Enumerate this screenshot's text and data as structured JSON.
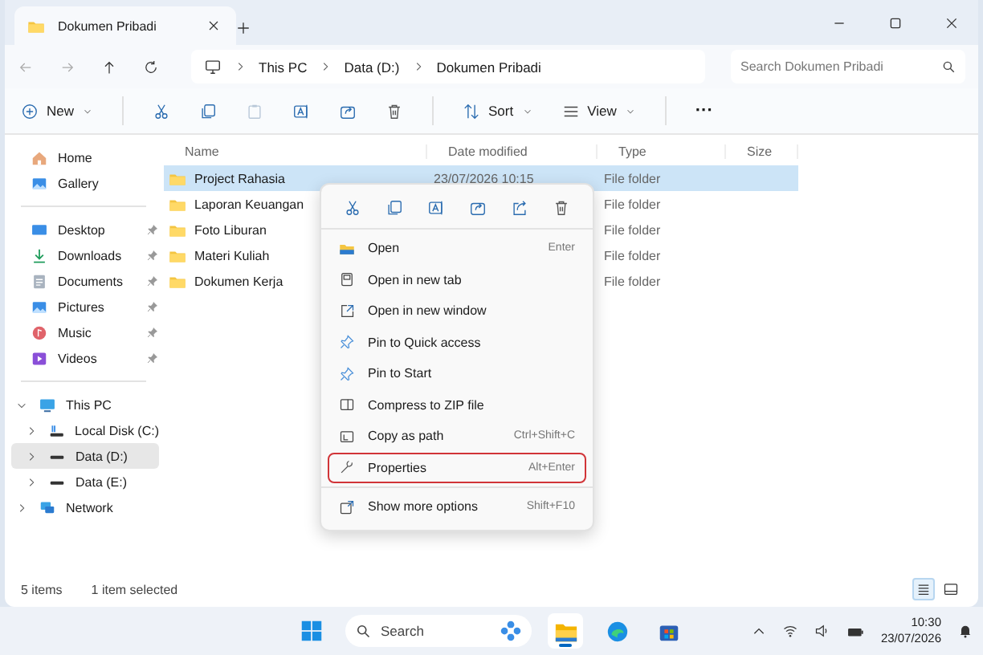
{
  "window": {
    "tab_title": "Dokumen Pribadi"
  },
  "breadcrumb": [
    "This PC",
    "Data (D:)",
    "Dokumen Pribadi"
  ],
  "search": {
    "placeholder": "Search Dokumen Pribadi"
  },
  "toolbar": {
    "new": "New",
    "sort": "Sort",
    "view": "View",
    "more": "···"
  },
  "sidebar": {
    "top": [
      {
        "label": "Home",
        "kind": "home",
        "pinned": false
      },
      {
        "label": "Gallery",
        "kind": "gallery",
        "pinned": false
      }
    ],
    "quick_access": [
      {
        "label": "Desktop",
        "kind": "desktop",
        "pinned": true
      },
      {
        "label": "Downloads",
        "kind": "download",
        "pinned": true
      },
      {
        "label": "Documents",
        "kind": "document",
        "pinned": true
      },
      {
        "label": "Pictures",
        "kind": "picture",
        "pinned": true
      },
      {
        "label": "Music",
        "kind": "music",
        "pinned": true
      },
      {
        "label": "Videos",
        "kind": "video",
        "pinned": true
      }
    ],
    "tree": [
      {
        "label": "This PC",
        "kind": "pc",
        "expanded": true,
        "selected": false,
        "children": [
          {
            "label": "Local Disk (C:)",
            "kind": "system-drive",
            "expanded": false,
            "selected": false
          },
          {
            "label": "Data (D:)",
            "kind": "drive",
            "expanded": false,
            "selected": true
          },
          {
            "label": "Data (E:)",
            "kind": "drive",
            "expanded": false,
            "selected": false
          }
        ]
      },
      {
        "label": "Network",
        "kind": "network",
        "expanded": false,
        "selected": false
      }
    ]
  },
  "table": {
    "columns": [
      "Name",
      "Date modified",
      "Type",
      "Size"
    ],
    "rows": [
      {
        "name": "Project Rahasia",
        "date": "23/07/2026 10:15",
        "type": "File folder",
        "selected": true
      },
      {
        "name": "Laporan Keuangan",
        "type": "File folder",
        "selected": false
      },
      {
        "name": "Foto Liburan",
        "type": "File folder",
        "selected": false
      },
      {
        "name": "Materi Kuliah",
        "type": "File folder",
        "selected": false
      },
      {
        "name": "Dokumen Kerja",
        "type": "File folder",
        "selected": false
      }
    ]
  },
  "context_menu": {
    "quick_actions": [
      {
        "kind": "cut"
      },
      {
        "kind": "copy"
      },
      {
        "kind": "rename"
      },
      {
        "kind": "share"
      },
      {
        "kind": "share-out"
      },
      {
        "kind": "delete"
      }
    ],
    "items": [
      {
        "label": "Open",
        "shortcut": "Enter",
        "kind": "open",
        "focused": false
      },
      {
        "label": "Open in new tab",
        "kind": "new-tab",
        "focused": false
      },
      {
        "label": "Open in new window",
        "kind": "new-window",
        "focused": false
      },
      {
        "label": "Pin to Quick access",
        "kind": "pin",
        "focused": false
      },
      {
        "label": "Pin to Start",
        "kind": "pin",
        "focused": false
      },
      {
        "label": "Compress to ZIP file",
        "kind": "zip",
        "focused": false
      },
      {
        "label": "Copy as path",
        "shortcut": "Ctrl+Shift+C",
        "kind": "path",
        "focused": false
      },
      {
        "label": "Properties",
        "shortcut": "Alt+Enter",
        "kind": "properties",
        "focused": true
      }
    ],
    "footer": {
      "label": "Show more options",
      "shortcut": "Shift+F10",
      "kind": "more-options"
    }
  },
  "status_bar": {
    "count": "5 items",
    "selection": "1 item selected",
    "views": [
      {
        "kind": "details",
        "selected": true
      },
      {
        "kind": "preview",
        "selected": false
      }
    ]
  },
  "taskbar": {
    "search_placeholder": "Search",
    "apps": [
      {
        "kind": "explorer",
        "active": true
      },
      {
        "kind": "edge",
        "active": false
      },
      {
        "kind": "store",
        "active": false
      }
    ],
    "clock": {
      "time": "10:30",
      "date": "23/07/2026"
    }
  }
}
